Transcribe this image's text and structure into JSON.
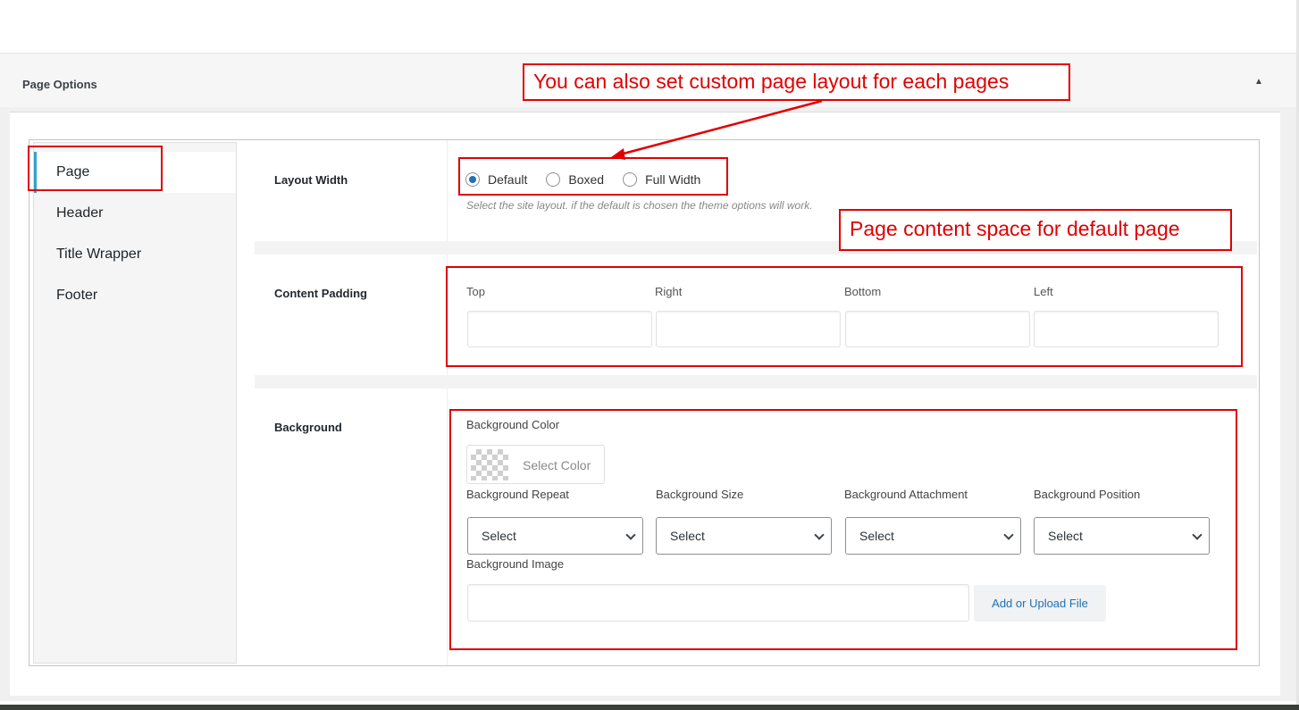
{
  "panel": {
    "title": "Page Options",
    "toggle_icon": "triangle-up-icon"
  },
  "sidebar": {
    "items": [
      {
        "label": "Page",
        "active": true
      },
      {
        "label": "Header",
        "active": false
      },
      {
        "label": "Title Wrapper",
        "active": false
      },
      {
        "label": "Footer",
        "active": false
      }
    ]
  },
  "layout_width": {
    "label": "Layout Width",
    "options": [
      {
        "label": "Default",
        "checked": true
      },
      {
        "label": "Boxed",
        "checked": false
      },
      {
        "label": "Full Width",
        "checked": false
      }
    ],
    "description": "Select the site layout. if the default is chosen the theme options will work."
  },
  "content_padding": {
    "label": "Content Padding",
    "fields": [
      {
        "label": "Top",
        "value": ""
      },
      {
        "label": "Right",
        "value": ""
      },
      {
        "label": "Bottom",
        "value": ""
      },
      {
        "label": "Left",
        "value": ""
      }
    ]
  },
  "background": {
    "label": "Background",
    "color_label": "Background Color",
    "color_button": "Select Color",
    "selects": [
      {
        "label": "Background Repeat",
        "value": "Select"
      },
      {
        "label": "Background Size",
        "value": "Select"
      },
      {
        "label": "Background Attachment",
        "value": "Select"
      },
      {
        "label": "Background Position",
        "value": "Select"
      }
    ],
    "image_label": "Background Image",
    "image_value": "",
    "upload_button": "Add or Upload File"
  },
  "annotations": {
    "layout_note": "You can also set custom page  layout  for each pages",
    "padding_note": "Page content  space for default page"
  },
  "colors": {
    "accent": "#2271b1",
    "active_tab_border": "#2ea2cc",
    "annotation": "#e00000"
  }
}
